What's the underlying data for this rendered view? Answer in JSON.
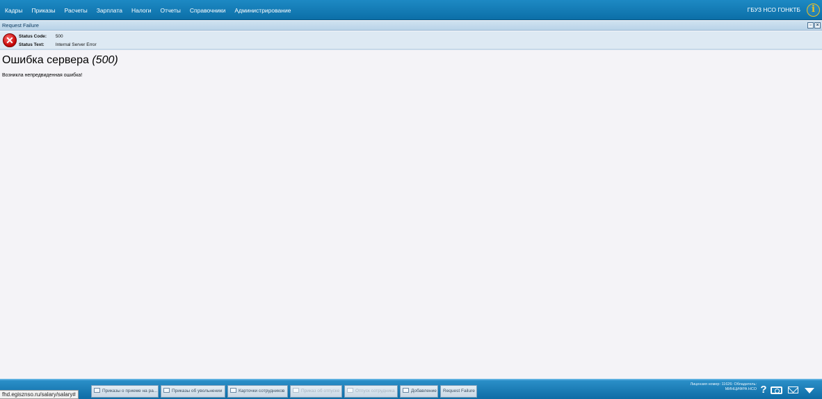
{
  "menu": {
    "items": [
      "Кадры",
      "Приказы",
      "Расчеты",
      "Зарплата",
      "Налоги",
      "Отчеты",
      "Справочники",
      "Администрирование"
    ],
    "org_name": "ГБУЗ НСО ГОНКТБ"
  },
  "window": {
    "title": "Request Failure"
  },
  "status": {
    "code_label": "Status Code:",
    "code_value": "500",
    "text_label": "Status Text:",
    "text_value": "Internal Server Error"
  },
  "content": {
    "heading": "Ошибка сервера",
    "heading_code": "(500)",
    "message": "Возникла непредвиденная ошибка!"
  },
  "taskbar": {
    "tasks": [
      {
        "label": "Приказы о приеме на ра...",
        "disabled": false
      },
      {
        "label": "Приказы об увольнении",
        "disabled": false
      },
      {
        "label": "Карточки сотрудников",
        "disabled": false
      },
      {
        "label": "Приказ об отпуске",
        "disabled": true
      },
      {
        "label": "Отпуск сотрудника",
        "disabled": true
      },
      {
        "label": "Добавление",
        "disabled": false
      },
      {
        "label": "Request Failure",
        "disabled": false
      }
    ],
    "license_line1": "Лицензия номер: 11626: Обладатель:",
    "license_line2": "МИНЦИФРА НСО",
    "help_glyph": "?"
  },
  "browser": {
    "status_url": "fhd.egisznso.ru/salary/salary#"
  },
  "icons": {
    "info": "info-icon",
    "error": "error-icon",
    "help": "help-icon",
    "camera": "camera-icon",
    "mail": "mail-icon",
    "menu_toggle": "arrow-down-icon"
  },
  "colors": {
    "menubar": "#0c6fa8",
    "accent_info": "#f2c21b",
    "error": "#c00000",
    "panel": "#dde9f3"
  }
}
